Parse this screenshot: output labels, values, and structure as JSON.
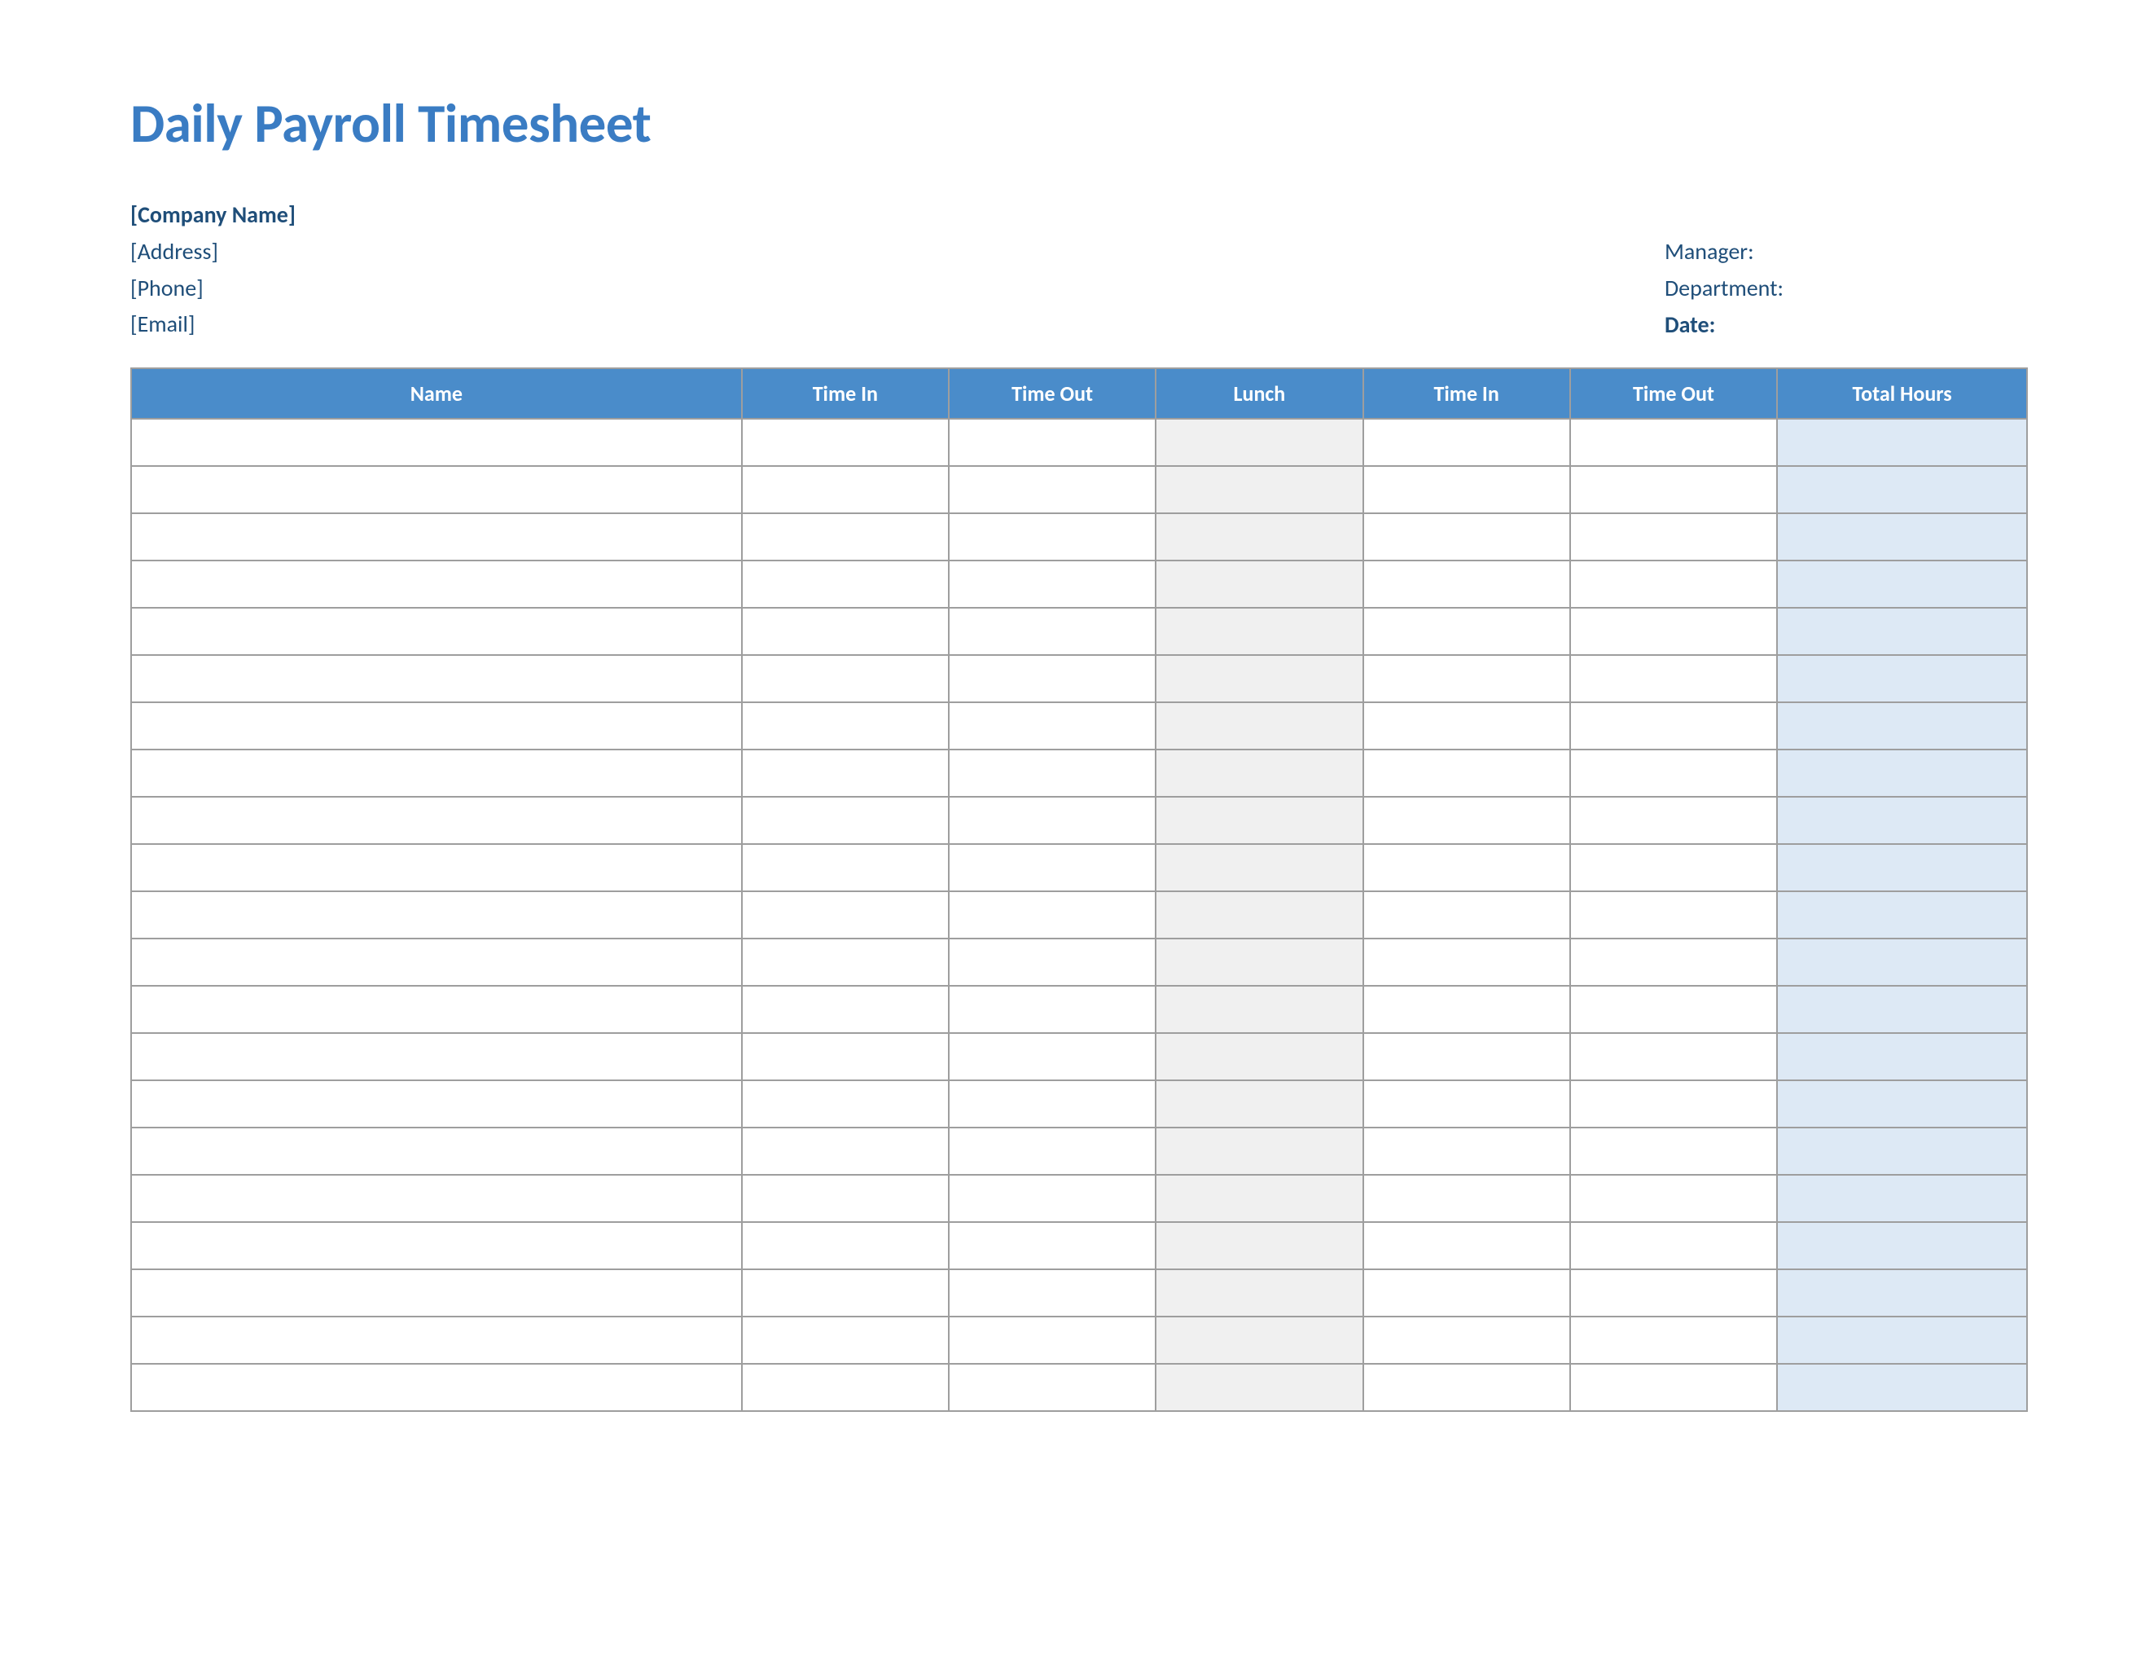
{
  "title": "Daily Payroll Timesheet",
  "company": {
    "name": "[Company Name]",
    "address": "[Address]",
    "phone": "[Phone]",
    "email": "[Email]"
  },
  "meta": {
    "manager_label": "Manager:",
    "department_label": "Department:",
    "date_label": "Date:"
  },
  "table": {
    "headers": {
      "name": "Name",
      "time_in_1": "Time In",
      "time_out_1": "Time Out",
      "lunch": "Lunch",
      "time_in_2": "Time In",
      "time_out_2": "Time Out",
      "total_hours": "Total Hours"
    },
    "rows": [
      {
        "name": "",
        "time_in_1": "",
        "time_out_1": "",
        "lunch": "",
        "time_in_2": "",
        "time_out_2": "",
        "total_hours": ""
      },
      {
        "name": "",
        "time_in_1": "",
        "time_out_1": "",
        "lunch": "",
        "time_in_2": "",
        "time_out_2": "",
        "total_hours": ""
      },
      {
        "name": "",
        "time_in_1": "",
        "time_out_1": "",
        "lunch": "",
        "time_in_2": "",
        "time_out_2": "",
        "total_hours": ""
      },
      {
        "name": "",
        "time_in_1": "",
        "time_out_1": "",
        "lunch": "",
        "time_in_2": "",
        "time_out_2": "",
        "total_hours": ""
      },
      {
        "name": "",
        "time_in_1": "",
        "time_out_1": "",
        "lunch": "",
        "time_in_2": "",
        "time_out_2": "",
        "total_hours": ""
      },
      {
        "name": "",
        "time_in_1": "",
        "time_out_1": "",
        "lunch": "",
        "time_in_2": "",
        "time_out_2": "",
        "total_hours": ""
      },
      {
        "name": "",
        "time_in_1": "",
        "time_out_1": "",
        "lunch": "",
        "time_in_2": "",
        "time_out_2": "",
        "total_hours": ""
      },
      {
        "name": "",
        "time_in_1": "",
        "time_out_1": "",
        "lunch": "",
        "time_in_2": "",
        "time_out_2": "",
        "total_hours": ""
      },
      {
        "name": "",
        "time_in_1": "",
        "time_out_1": "",
        "lunch": "",
        "time_in_2": "",
        "time_out_2": "",
        "total_hours": ""
      },
      {
        "name": "",
        "time_in_1": "",
        "time_out_1": "",
        "lunch": "",
        "time_in_2": "",
        "time_out_2": "",
        "total_hours": ""
      },
      {
        "name": "",
        "time_in_1": "",
        "time_out_1": "",
        "lunch": "",
        "time_in_2": "",
        "time_out_2": "",
        "total_hours": ""
      },
      {
        "name": "",
        "time_in_1": "",
        "time_out_1": "",
        "lunch": "",
        "time_in_2": "",
        "time_out_2": "",
        "total_hours": ""
      },
      {
        "name": "",
        "time_in_1": "",
        "time_out_1": "",
        "lunch": "",
        "time_in_2": "",
        "time_out_2": "",
        "total_hours": ""
      },
      {
        "name": "",
        "time_in_1": "",
        "time_out_1": "",
        "lunch": "",
        "time_in_2": "",
        "time_out_2": "",
        "total_hours": ""
      },
      {
        "name": "",
        "time_in_1": "",
        "time_out_1": "",
        "lunch": "",
        "time_in_2": "",
        "time_out_2": "",
        "total_hours": ""
      },
      {
        "name": "",
        "time_in_1": "",
        "time_out_1": "",
        "lunch": "",
        "time_in_2": "",
        "time_out_2": "",
        "total_hours": ""
      },
      {
        "name": "",
        "time_in_1": "",
        "time_out_1": "",
        "lunch": "",
        "time_in_2": "",
        "time_out_2": "",
        "total_hours": ""
      },
      {
        "name": "",
        "time_in_1": "",
        "time_out_1": "",
        "lunch": "",
        "time_in_2": "",
        "time_out_2": "",
        "total_hours": ""
      },
      {
        "name": "",
        "time_in_1": "",
        "time_out_1": "",
        "lunch": "",
        "time_in_2": "",
        "time_out_2": "",
        "total_hours": ""
      },
      {
        "name": "",
        "time_in_1": "",
        "time_out_1": "",
        "lunch": "",
        "time_in_2": "",
        "time_out_2": "",
        "total_hours": ""
      },
      {
        "name": "",
        "time_in_1": "",
        "time_out_1": "",
        "lunch": "",
        "time_in_2": "",
        "time_out_2": "",
        "total_hours": ""
      }
    ]
  }
}
